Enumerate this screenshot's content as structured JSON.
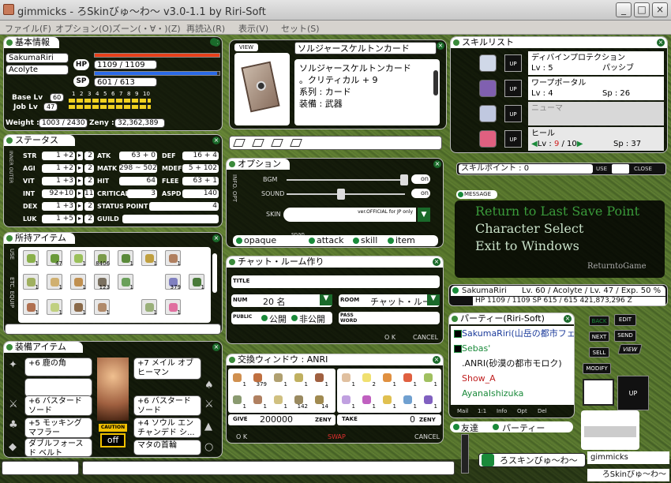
{
  "window": {
    "title": "gimmicks - ろSkinびゅ～わ～ v3.0-1.1 by Riri-Soft",
    "min": "_",
    "max": "□",
    "close": "×"
  },
  "menu": [
    "ファイル(F)",
    "オプション(O)",
    "ズーン(・∀・)(Z)",
    "再読込(R)",
    "表示(V)",
    "セット(S)"
  ],
  "basic": {
    "title": "基本情報",
    "name": "SakumaRiri",
    "job": "Acolyte",
    "hp_label": "HP",
    "hp": "1109 / 1109",
    "sp_label": "SP",
    "sp": "601 / 613",
    "base_label": "Base Lv",
    "base_lv": "60",
    "job_label": "Job Lv",
    "job_lv": "47",
    "ticks": [
      "1",
      "2",
      "3",
      "4",
      "5",
      "6",
      "7",
      "8",
      "9",
      "10"
    ],
    "weight_label": "Weight :",
    "weight": "1003 / 2430",
    "zeny_label": "Zeny :",
    "zeny": "32,362,389"
  },
  "card": {
    "view": "VIEW",
    "name": "ソルジャースケルトンカード",
    "lines": [
      "ソルジャースケルトンカード",
      "。クリティカル + 9",
      "系列 : カード",
      "装備 : 武器"
    ]
  },
  "status": {
    "title": "ステータス",
    "side": "INNER OUTER",
    "stats": [
      {
        "label": "STR",
        "val": "1 +2",
        "pts": "2"
      },
      {
        "label": "AGI",
        "val": "1 +2",
        "pts": "2"
      },
      {
        "label": "VIT",
        "val": "1 +3",
        "pts": "2"
      },
      {
        "label": "INT",
        "val": "92+10",
        "pts": "11"
      },
      {
        "label": "DEX",
        "val": "1 +3",
        "pts": "2"
      },
      {
        "label": "LUK",
        "val": "1 +5",
        "pts": "2"
      }
    ],
    "mid": [
      {
        "label": "ATK",
        "val": "63 + 0"
      },
      {
        "label": "MATK",
        "val": "298 ~ 502"
      },
      {
        "label": "HIT",
        "val": "64"
      },
      {
        "label": "CRITICAL",
        "val": "3"
      }
    ],
    "right": [
      {
        "label": "DEF",
        "val": "16 + 4"
      },
      {
        "label": "MDEF",
        "val": "5 + 102"
      },
      {
        "label": "FLEE",
        "val": "63 + 1"
      },
      {
        "label": "ASPD",
        "val": "140"
      }
    ],
    "status_point_label": "STATUS POINT",
    "status_point": "4",
    "guild_label": "GUILD",
    "guild": ""
  },
  "inventory": {
    "title": "所持アイテム",
    "tabs": [
      "USE",
      "ETC. EQUIP"
    ],
    "quantities": [
      "1",
      "47",
      "1",
      "8406",
      "1",
      "1",
      "1",
      "1",
      "1",
      "1",
      "123",
      "1",
      "379",
      "1",
      "1",
      "1",
      "1",
      "1",
      "1",
      "1"
    ]
  },
  "equip": {
    "title": "装備アイテム",
    "left": [
      "+6 鹿の角",
      "",
      "+6 バスタードソード",
      "+5 モッキングマフラー",
      "ダブルフォースド ベルト"
    ],
    "right": [
      "+7 メイル オブ ヒーマン",
      "+6 バスタードソード",
      "+4 ソウル エンチャンデド シ...",
      "マタの首輪"
    ],
    "caution": "CAUTION",
    "off": "off"
  },
  "option": {
    "title": "オプション",
    "side": "INFO. OPT",
    "bgm": "BGM",
    "sound": "SOUND",
    "on1": "on",
    "on2": "on",
    "skin": "SKIN",
    "skin_val": "ver.OFFICIAL for JP only",
    "snap": "snap",
    "checks": [
      "opaque",
      "attack",
      "skill",
      "item"
    ]
  },
  "chat": {
    "title": "チャット・ルーム作り",
    "title_label": "TITLE",
    "num_label": "NUM",
    "num": "20 名",
    "room_label": "ROOM",
    "room": "チャット・ルー",
    "public_label": "PUBLIC",
    "opt1": "公開",
    "opt2": "非公開",
    "pass_label": "PASS WORD",
    "ok": "O K",
    "cancel": "CANCEL"
  },
  "trade": {
    "title": "交換ウィンドウ : ANRI",
    "left_q": [
      "1",
      "379",
      "1",
      "1",
      "1",
      "1",
      "1",
      "1",
      "142",
      "14"
    ],
    "right_q": [
      "1",
      "2",
      "1",
      "1",
      "1",
      "1",
      "1",
      "1",
      "1",
      "1"
    ],
    "give": "GIVE",
    "give_val": "200000",
    "zeny": "ZENY",
    "take": "TAKE",
    "take_val": "0",
    "ok": "O K",
    "swap": "SWAP",
    "cancel": "CANCEL"
  },
  "skills": {
    "title": "スキルリスト",
    "items": [
      {
        "name": "ディバインプロテクション",
        "lv": "Lv : 5",
        "info": "パッシブ",
        "up": "UP"
      },
      {
        "name": "ワープポータル",
        "lv": "Lv : 4",
        "info": "Sp : 26",
        "up": "UP"
      },
      {
        "name": "ニューマ",
        "lv": "",
        "info": "",
        "up": "UP"
      },
      {
        "name": "ヒール",
        "lv": "Lv :",
        "cur": "9",
        "max": "/ 10",
        "info": "Sp : 37",
        "up": "UP"
      }
    ],
    "points": "スキルポイント : 0",
    "use": "USE",
    "close": "CLOSE"
  },
  "message": {
    "label": "MESSAGE",
    "lines": [
      "Return to Last Save Point",
      "Character Select",
      "Exit to Windows"
    ],
    "ret": "ReturntoGame"
  },
  "char": {
    "title": "SakumaRiri",
    "info": "Lv. 60 / Acolyte / Lv. 47 / Exp. 50 %",
    "stats": "HP 1109 / 1109  SP 615 / 615  421,873,296 Z"
  },
  "party": {
    "title": "パーティー(Riri-Soft)",
    "members": [
      "SakumaRiri(山岳の都市フェ",
      "Sebas'",
      ".ANRI(砂漠の都市モロク)",
      "Show_A",
      "AyanaIshizuka"
    ],
    "buttons": [
      "Mail",
      "1:1",
      "Info",
      "Opt",
      "Del"
    ]
  },
  "side": {
    "back": "BACK",
    "edit": "EDIT",
    "next": "NEXT",
    "send": "SEND",
    "sell": "SELL",
    "view": "VIEW",
    "modify": "MODIFY",
    "up": "UP"
  },
  "friends": {
    "label": "友達",
    "party": "パーティー"
  },
  "nick": "gimmicks",
  "bottom_name": "ろスキンびゅ～わ～",
  "bottom_name2": "ろSkinびゅ～わ～",
  "colors": {
    "panel": "#111111",
    "accent": "#1a8a3a",
    "hp": "#e8401a",
    "sp": "#2a6ae8"
  }
}
